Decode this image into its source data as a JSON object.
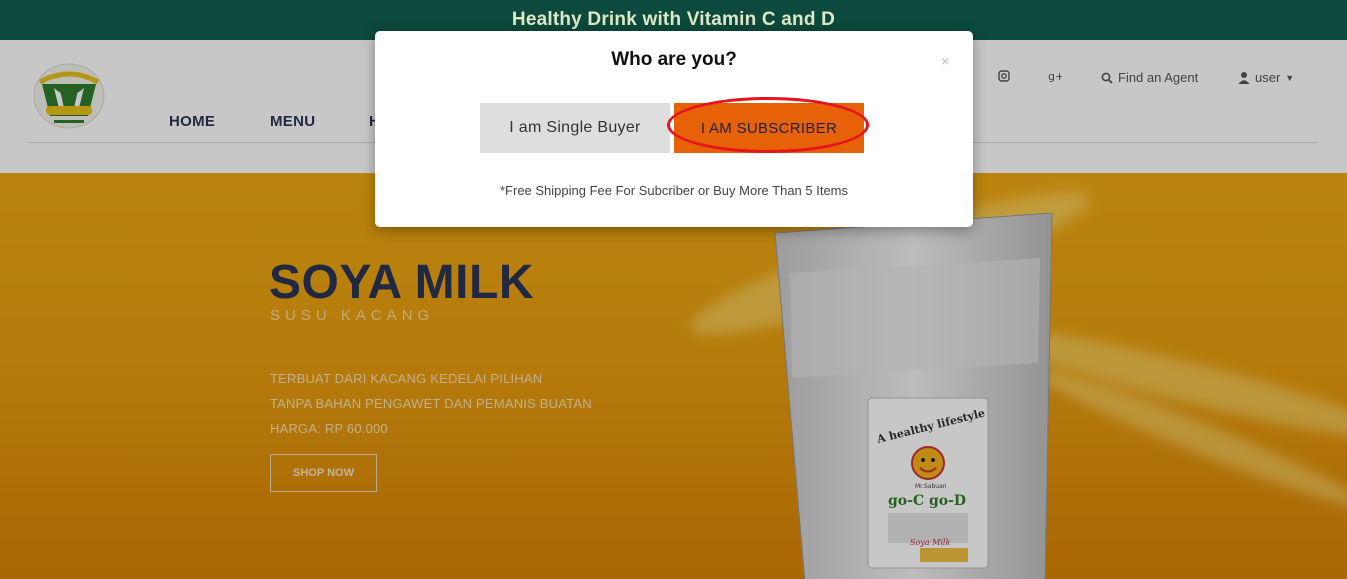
{
  "topbar": {
    "tagline": "Healthy Drink with Vitamin C and D"
  },
  "header": {
    "nav": [
      {
        "label": "HOME"
      },
      {
        "label": "MENU"
      },
      {
        "label": "H"
      }
    ],
    "utility": {
      "find_agent": "Find an Agent",
      "user": "user"
    }
  },
  "hero": {
    "title": "SOYA MILK",
    "subtitle": "SUSU KACANG",
    "lines": [
      "TERBUAT DARI KACANG KEDELAI PILIHAN",
      "TANPA BAHAN PENGAWET DAN PEMANIS BUATAN",
      "HARGA: RP 60.000"
    ],
    "cta": "SHOP NOW",
    "package": {
      "tagline": "A healthy lifestyle",
      "brand_small": "Mr.Sabuan",
      "brand": "go-C go-D",
      "product": "Soya Milk"
    }
  },
  "modal": {
    "title": "Who are you?",
    "close": "×",
    "option_single": "I am Single Buyer",
    "option_subscriber": "I AM SUBSCRIBER",
    "note": "*Free Shipping Fee For Subcriber or Buy More Than 5 Items"
  },
  "colors": {
    "topbar": "#0b4a3c",
    "hero": "#f1aa12",
    "subscriber_button": "#e76106",
    "highlight_ring": "#e5141e"
  }
}
